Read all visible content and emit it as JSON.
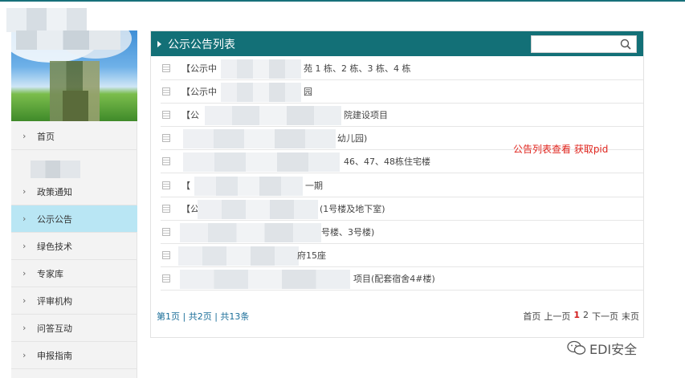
{
  "sidebar": {
    "items": [
      {
        "label": "首页",
        "active": false
      },
      {
        "label": "政策通知",
        "active": false
      },
      {
        "label": "公示公告",
        "active": true
      },
      {
        "label": "绿色技术",
        "active": false
      },
      {
        "label": "专家库",
        "active": false
      },
      {
        "label": "评审机构",
        "active": false
      },
      {
        "label": "问答互动",
        "active": false
      },
      {
        "label": "申报指南",
        "active": false
      }
    ]
  },
  "panel": {
    "title": "公示公告列表",
    "search_placeholder": "",
    "rows": [
      {
        "prefix": "【公示中",
        "suffix": "苑 1 栋、2 栋、3 栋、4 栋"
      },
      {
        "prefix": "【公示中",
        "suffix": "园"
      },
      {
        "prefix": "【公",
        "suffix": "院建设项目"
      },
      {
        "prefix": "",
        "suffix": "幼儿园)"
      },
      {
        "prefix": "",
        "suffix": "46、47、48栋住宅楼"
      },
      {
        "prefix": "【",
        "suffix": "一期"
      },
      {
        "prefix": "【公",
        "suffix": "(1号楼及地下室)"
      },
      {
        "prefix": "",
        "suffix": "号楼、3号楼)"
      },
      {
        "prefix": "",
        "suffix": "府15座"
      },
      {
        "prefix": "",
        "suffix": "项目(配套宿舍4#楼)"
      }
    ],
    "pager_summary": "第1页 | 共2页 | 共13条",
    "pager": {
      "first": "首页",
      "prev": "上一页",
      "page1": "1",
      "page2": "2",
      "next": "下一页",
      "last": "末页"
    }
  },
  "annotation": "公告列表查看 获取pid",
  "watermark": "EDI安全",
  "colors": {
    "header_bg": "#137077",
    "active_nav": "#b9e6f4",
    "annotation": "#e0251e",
    "current_page": "#d21a1a"
  },
  "icons": [
    "search-icon",
    "chevron-right-icon",
    "document-icon",
    "wechat-icon"
  ]
}
